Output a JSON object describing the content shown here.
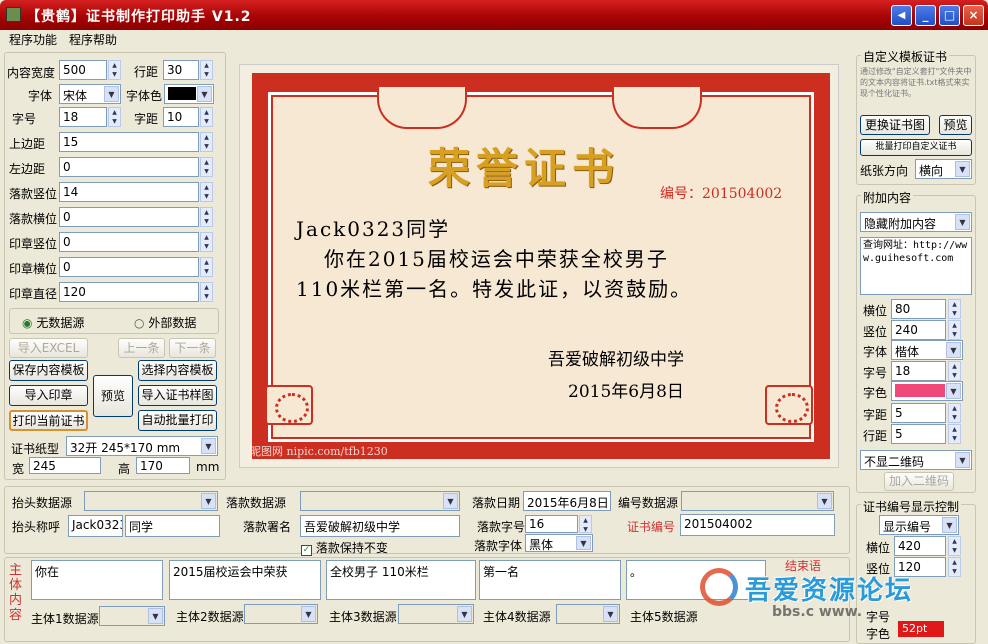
{
  "window": {
    "title": "【贵鹤】证书制作打印助手 V1.2",
    "btn_extra": "◀",
    "btn_min": "_",
    "btn_max": "□",
    "btn_close": "×"
  },
  "menu": [
    "程序功能",
    "程序帮助"
  ],
  "left": {
    "content_width_label": "内容宽度",
    "content_width": "500",
    "line_spacing_label": "行距",
    "line_spacing": "30",
    "font_label": "字体",
    "font": "宋体",
    "font_color_label": "字体色",
    "font_size_label": "字号",
    "font_size": "18",
    "char_spacing_label": "字距",
    "char_spacing": "10",
    "top_margin_label": "上边距",
    "top_margin": "15",
    "left_margin_label": "左边距",
    "left_margin": "0",
    "sig_v_label": "落款竖位",
    "sig_v": "14",
    "sig_h_label": "落款横位",
    "sig_h": "0",
    "seal_v_label": "印章竖位",
    "seal_v": "0",
    "seal_h_label": "印章横位",
    "seal_h": "0",
    "seal_d_label": "印章直径",
    "seal_d": "120",
    "radio_none": "无数据源",
    "radio_ext": "外部数据",
    "import_excel": "导入EXCEL",
    "prev": "上一条",
    "next": "下一条",
    "save_tpl": "保存内容模板",
    "select_tpl": "选择内容模板",
    "import_seal": "导入印章",
    "preview": "预览",
    "import_sample": "导入证书样图",
    "print_current": "打印当前证书",
    "auto_batch": "自动批量打印",
    "paper_label": "证书纸型",
    "paper": "32开 245*170 mm",
    "width_label": "宽",
    "width": "245",
    "height_label": "高",
    "height": "170",
    "unit": "mm"
  },
  "cert": {
    "title": "荣誉证书",
    "number": "编号：201504002",
    "name": "Jack0323同学",
    "line1": "你在2015届校运会中荣获全校男子",
    "line2": "110米栏第一名。特发此证，以资鼓励。",
    "school": "吾爱破解初级中学",
    "date": "2015年6月8日",
    "watermark": "昵图网 nipic.com/tfb1230"
  },
  "right": {
    "custom_title": "自定义模板证书",
    "custom_desc": "通过修改\"自定义套打\"文件夹中的文本内容将证书.txt格式来实现个性化证书。",
    "replace_img": "更换证书图",
    "preview": "预览",
    "batch_custom": "批量打印自定义证书",
    "paper_dir_label": "纸张方向",
    "paper_dir": "横向",
    "extra_title": "附加内容",
    "extra_mode": "隐藏附加内容",
    "extra_text": "查询网址：http://www.guihesoft.com",
    "h_label": "横位",
    "h": "80",
    "v_label": "竖位",
    "v": "240",
    "font_label": "字体",
    "font": "楷体",
    "size_label": "字号",
    "size": "18",
    "color_label": "字色",
    "spacing_label": "字距",
    "spacing": "5",
    "line_label": "行距",
    "line": "5",
    "qr": "不显二维码",
    "add_qr": "加入二维码",
    "num_title": "证书编号显示控制",
    "num_mode": "显示编号",
    "nh_label": "横位",
    "nh": "420",
    "nv_label": "竖位",
    "nv": "120",
    "nsize_label": "字号",
    "nsize": "52pt",
    "ncolor_label": "字色",
    "ncolor": "52pt"
  },
  "bottom": {
    "head_src_label": "抬头数据源",
    "sig_src_label": "落款数据源",
    "sig_date_label": "落款日期",
    "sig_date": "2015年6月8日",
    "num_src_label": "编号数据源",
    "head_call_label": "抬头称呼",
    "head_name": "Jack0323",
    "head_suffix": "同学",
    "sig_name_label": "落款署名",
    "sig_name": "吾爱破解初级中学",
    "sig_size_label": "落款字号",
    "sig_size": "16",
    "cert_num_label": "证书编号",
    "cert_num": "201504002",
    "sig_keep": "落款保持不变",
    "sig_font_label": "落款字体",
    "sig_font": "黑体",
    "body_label": "主体内容",
    "end_label": "结束语",
    "body": [
      "你在",
      "2015届校运会中荣获",
      "全校男子 110米栏",
      "第一名",
      "。"
    ],
    "body_src": [
      "主体1数据源",
      "主体2数据源",
      "主体3数据源",
      "主体4数据源",
      "主体5数据源"
    ]
  },
  "overlay": {
    "watermark": "吾爱资源论坛",
    "watermark_url": "bbs.c  www.",
    "badge": "52pt"
  },
  "colors": {
    "accent": "#cc2e20",
    "gold": "#d8a020",
    "font_color": "#000000",
    "extra_color": "#f04878"
  }
}
